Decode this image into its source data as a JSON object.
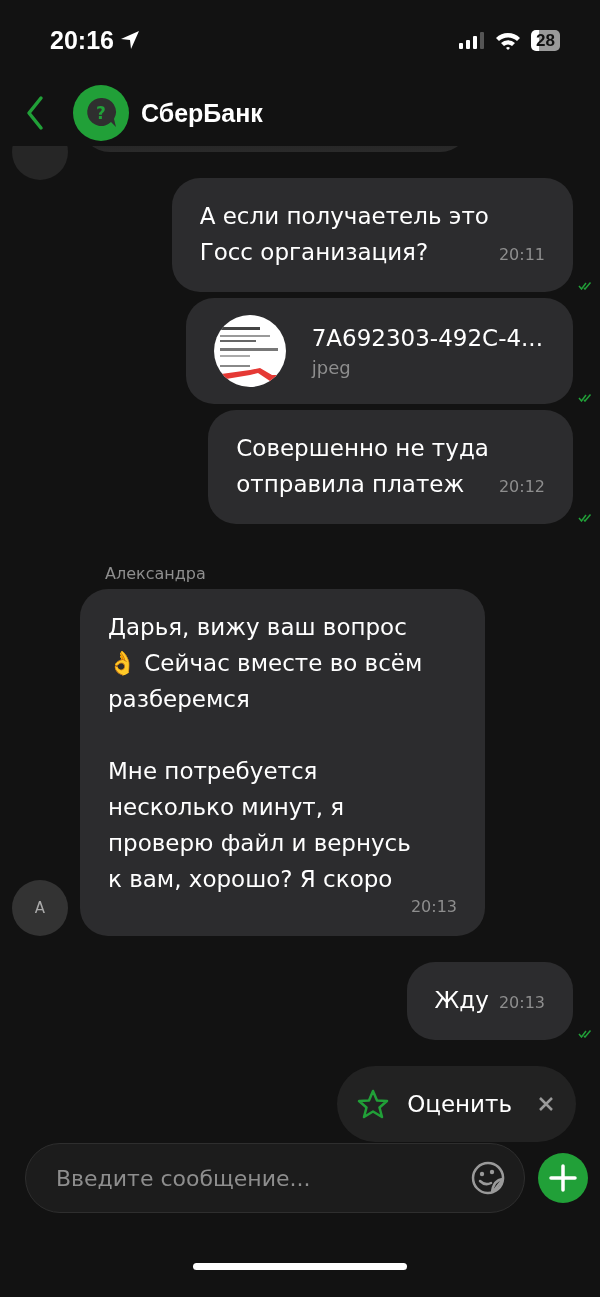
{
  "status_bar": {
    "time": "20:16",
    "battery": "28"
  },
  "header": {
    "avatar_glyph": "?",
    "title": "СберБанк"
  },
  "messages": [
    {
      "kind": "clipped"
    },
    {
      "kind": "outgoing",
      "text": "А если получаетель это\nГосс организация?",
      "time": "20:11",
      "read": true
    },
    {
      "kind": "file",
      "file_name": "7A692303-492C-4...",
      "file_type": "jpeg",
      "read": true
    },
    {
      "kind": "outgoing",
      "text": "Совершенно не туда\nотправила платеж",
      "time": "20:12",
      "read": true
    },
    {
      "kind": "incoming",
      "sender": "Александра",
      "avatar": "А",
      "text": "Дарья, вижу ваш вопрос\n👌 Сейчас вместе во всём\nразберемся\n\nМне потребуется\nнесколько минут, я\nпроверю файл и вернусь\nк вам, хорошо? Я скоро",
      "time": "20:13"
    },
    {
      "kind": "outgoing",
      "text": "Жду",
      "time": "20:13",
      "read": true
    }
  ],
  "rate_chip": {
    "label": "Оценить"
  },
  "composer": {
    "placeholder": "Введите сообщение..."
  }
}
